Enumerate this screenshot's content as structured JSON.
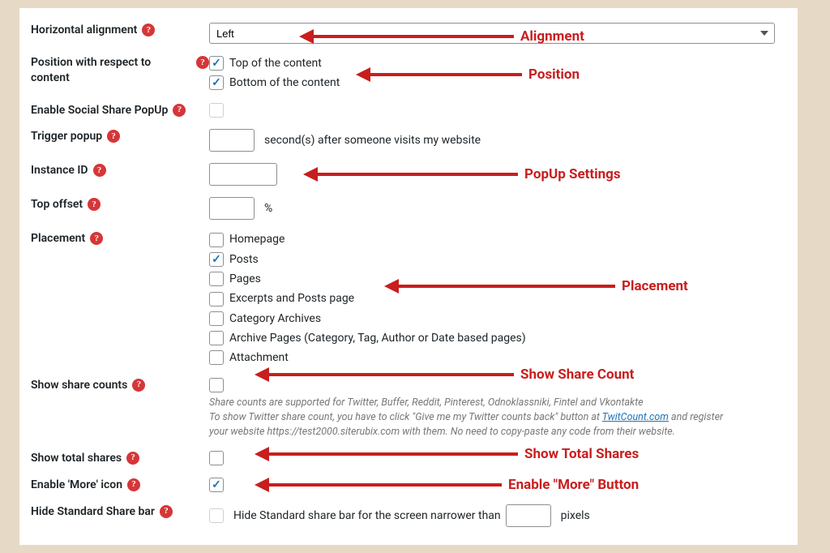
{
  "labels": {
    "horizontal_alignment": "Horizontal alignment",
    "position_content": "Position with respect to content",
    "enable_popup": "Enable Social Share PopUp",
    "trigger_popup": "Trigger popup",
    "instance_id": "Instance ID",
    "top_offset": "Top offset",
    "placement": "Placement",
    "show_counts": "Show share counts",
    "show_total": "Show total shares",
    "enable_more": "Enable 'More' icon",
    "hide_bar": "Hide Standard Share bar"
  },
  "controls": {
    "alignment_value": "Left",
    "top_of_content": "Top of the content",
    "bottom_of_content": "Bottom of the content",
    "trigger_suffix": "second(s) after someone visits my website",
    "top_offset_unit": "%",
    "placement_items": [
      {
        "label": "Homepage",
        "checked": false
      },
      {
        "label": "Posts",
        "checked": true
      },
      {
        "label": "Pages",
        "checked": false
      },
      {
        "label": "Excerpts and Posts page",
        "checked": false
      },
      {
        "label": "Category Archives",
        "checked": false
      },
      {
        "label": "Archive Pages (Category, Tag, Author or Date based pages)",
        "checked": false
      },
      {
        "label": "Attachment",
        "checked": false
      }
    ],
    "counts_note_1": "Share counts are supported for Twitter, Buffer, Reddit, Pinterest, Odnoklassniki, Fintel and Vkontakte",
    "counts_note_2a": "To show Twitter share count, you have to click \"Give me my Twitter counts back\" button at ",
    "counts_note_link": "TwitCount.com",
    "counts_note_2b": " and register your website https://test2000.siterubix.com with them. No need to copy-paste any code from their website.",
    "hide_bar_prefix": "Hide Standard share bar for the screen narrower than",
    "hide_bar_suffix": "pixels"
  },
  "annotations": {
    "alignment": "Alignment",
    "position": "Position",
    "popup": "PopUp Settings",
    "placement": "Placement",
    "show_count": "Show Share Count",
    "show_total": "Show Total Shares",
    "enable_more": "Enable \"More\" Button"
  }
}
